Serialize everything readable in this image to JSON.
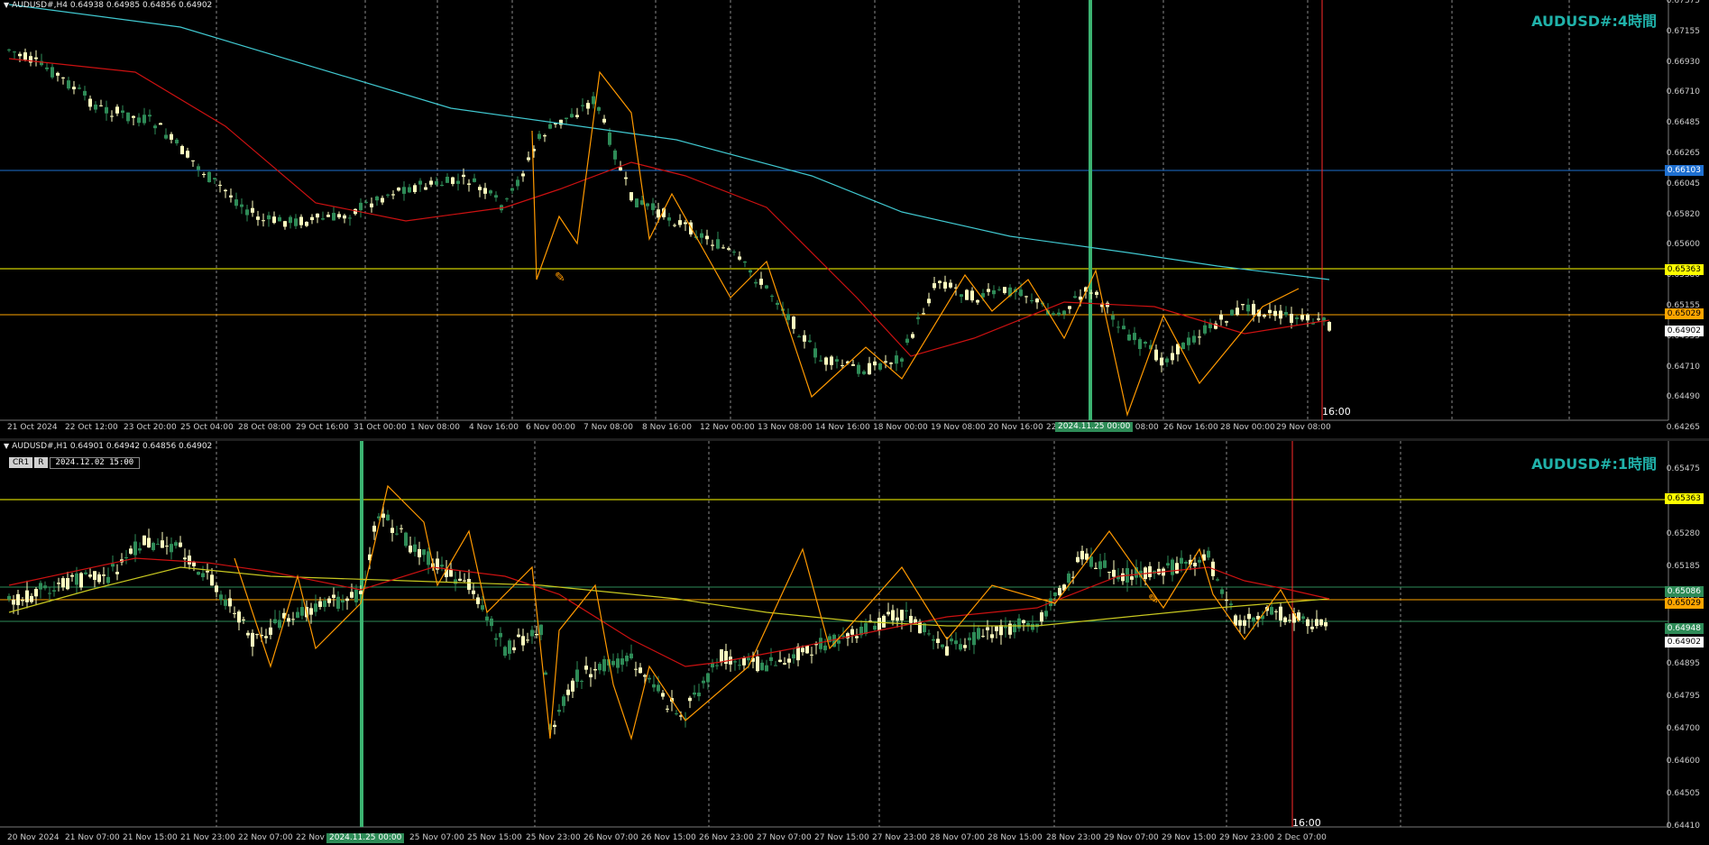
{
  "top": {
    "header": "AUDUSD#,H4  0.64938 0.64985 0.64856 0.64902",
    "symbol": "AUDUSD#:4時間",
    "price_labels": [
      "0.67375",
      "0.67155",
      "0.66930",
      "0.66710",
      "0.66485",
      "0.66265",
      "0.66045",
      "0.65820",
      "0.65600",
      "0.65380",
      "0.65155",
      "0.64935",
      "0.64710",
      "0.64490",
      "0.64265"
    ],
    "time_labels": [
      "21 Oct 2024",
      "22 Oct 12:00",
      "23 Oct 20:00",
      "25 Oct 04:00",
      "28 Oct 08:00",
      "29 Oct 16:00",
      "31 Oct 00:00",
      "1 Nov 08:00",
      "4 Nov 16:00",
      "6 Nov 00:00",
      "7 Nov 08:00",
      "8 Nov 16:00",
      "12 Nov 00:00",
      "13 Nov 08:00",
      "14 Nov 16:00",
      "18 Nov 00:00",
      "19 Nov 08:00",
      "20 Nov 16:00",
      "22 Nov",
      "25 Nov 08:00",
      "26 Nov 16:00",
      "28 Nov 00:00",
      "29 Nov 08:00"
    ],
    "highlight_time": "2024.11.25 00:00",
    "blue_level": "0.66103",
    "yellow_level": "0.65363",
    "orange_level": "0.65029",
    "current_price": "0.64902",
    "cursor_time": "16:00"
  },
  "bottom": {
    "header": "AUDUSD#,H1  0.64901 0.64942 0.64856 0.64902",
    "symbol": "AUDUSD#:1時間",
    "button_cr": "CR1",
    "button_r": "R",
    "datetime_box": "2024.12.02 15:00",
    "price_labels": [
      "0.65475",
      "0.65380",
      "0.65280",
      "0.65185",
      "0.65085",
      "0.64990",
      "0.64895",
      "0.64795",
      "0.64700",
      "0.64600",
      "0.64505",
      "0.64410"
    ],
    "time_labels": [
      "20 Nov 2024",
      "21 Nov 07:00",
      "21 Nov 15:00",
      "21 Nov 23:00",
      "22 Nov 07:00",
      "22 Nov",
      "25 Nov 07:00",
      "25 Nov 15:00",
      "25 Nov 23:00",
      "26 Nov 07:00",
      "26 Nov 15:00",
      "26 Nov 23:00",
      "27 Nov 07:00",
      "27 Nov 15:00",
      "27 Nov 23:00",
      "28 Nov 07:00",
      "28 Nov 15:00",
      "28 Nov 23:00",
      "29 Nov 07:00",
      "29 Nov 15:00",
      "29 Nov 23:00",
      "2 Dec 07:00"
    ],
    "highlight_time": "2024.11.25 00:00",
    "yellow_level": "0.65363",
    "green_level_1": "0.65086",
    "orange_level": "0.65029",
    "green_level_2": "0.64948",
    "current_price": "0.64902",
    "cursor_time": "16:00"
  },
  "colors": {
    "bull": "#ffffc0",
    "bear": "#2e8b57",
    "ma_fast": "#cc1111",
    "ma_slow_top": "#40c8d0",
    "ma_slow_bot": "#c8c820",
    "zigzag": "#ff9900",
    "grid": "#8a8a8a",
    "cursor": "#ff2a2a",
    "highlight": "#3cb371"
  }
}
